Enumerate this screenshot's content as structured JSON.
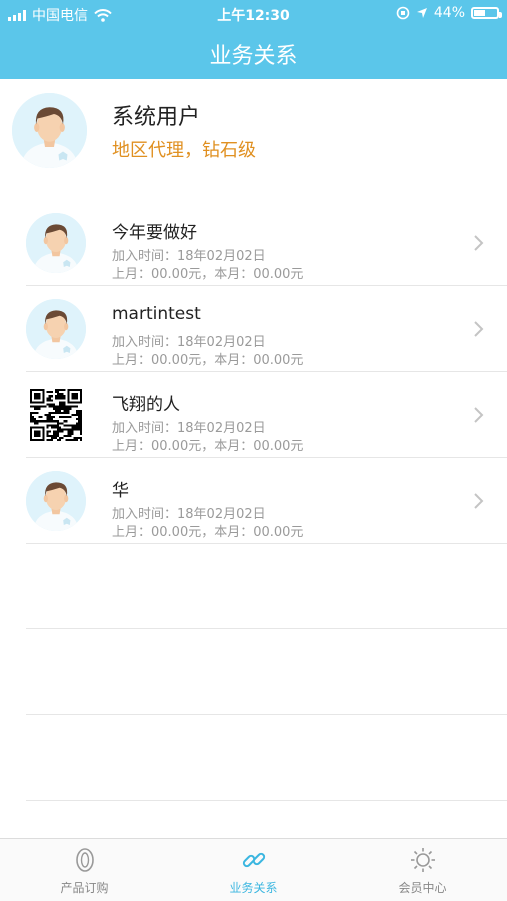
{
  "status_bar": {
    "carrier": "中国电信",
    "time": "上午12:30",
    "battery": "44%",
    "battery_level": 0.44
  },
  "header": {
    "title": "业务关系"
  },
  "profile": {
    "name": "系统用户",
    "role": "地区代理，钻石级"
  },
  "members": [
    {
      "name": "今年要做好",
      "joined": "加入时间：18年02月02日",
      "stats": "上月：00.00元，本月：00.00元",
      "avatar": "default-avatar"
    },
    {
      "name": "martintest",
      "joined": "加入时间：18年02月02日",
      "stats": "上月：00.00元，本月：00.00元",
      "avatar": "default-avatar"
    },
    {
      "name": "飞翔的人",
      "joined": "加入时间：18年02月02日",
      "stats": "上月：00.00元，本月：00.00元",
      "avatar": "qr-code"
    },
    {
      "name": "华",
      "joined": "加入时间：18年02月02日",
      "stats": "上月：00.00元，本月：00.00元",
      "avatar": "default-avatar"
    }
  ],
  "tabbar": {
    "tabs": [
      {
        "label": "产品订购",
        "icon": "capsule-icon",
        "active": false
      },
      {
        "label": "业务关系",
        "icon": "link-icon",
        "active": true
      },
      {
        "label": "会员中心",
        "icon": "sun-icon",
        "active": false
      }
    ]
  },
  "colors": {
    "header": "#5bc6ea",
    "accent": "#3bb6e0",
    "role_text": "#e09021",
    "secondary_text": "#9a9a9a"
  }
}
